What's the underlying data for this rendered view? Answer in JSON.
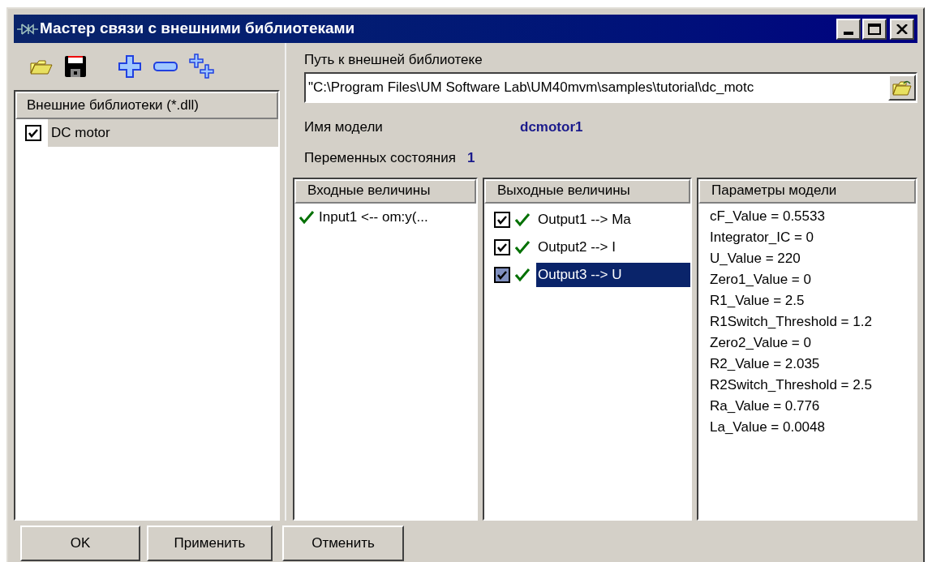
{
  "window": {
    "title": "Мастер связи с внешними библиотеками"
  },
  "libraries": {
    "header": "Внешние библиотеки (*.dll)",
    "items": [
      {
        "label": "DC motor",
        "checked": true,
        "selected": true
      }
    ]
  },
  "path": {
    "label": "Путь к внешней библиотеке",
    "value": "\"C:\\Program Files\\UM Software Lab\\UM40mvm\\samples\\tutorial\\dc_motc"
  },
  "model_name": {
    "label": "Имя модели",
    "value": "dcmotor1"
  },
  "state_vars": {
    "label": "Переменных состояния",
    "value": "1"
  },
  "inputs": {
    "header": "Входные величины",
    "items": [
      {
        "label": "Input1 <-- om:y(..."
      }
    ]
  },
  "outputs": {
    "header": "Выходные величины",
    "items": [
      {
        "label": "Output1 --> Ma",
        "checked": true,
        "selected": false
      },
      {
        "label": "Output2 --> I",
        "checked": true,
        "selected": false
      },
      {
        "label": "Output3 --> U",
        "checked": true,
        "selected": true
      }
    ]
  },
  "parameters": {
    "header": "Параметры модели",
    "items": [
      "cF_Value = 0.5533",
      "Integrator_IC = 0",
      "U_Value = 220",
      "Zero1_Value = 0",
      "R1_Value = 2.5",
      "R1Switch_Threshold = 1.2",
      "Zero2_Value = 0",
      "R2_Value = 2.035",
      "R2Switch_Threshold = 2.5",
      "Ra_Value = 0.776",
      "La_Value = 0.0048"
    ]
  },
  "buttons": [
    "OK",
    "Применить",
    "Отменить"
  ]
}
